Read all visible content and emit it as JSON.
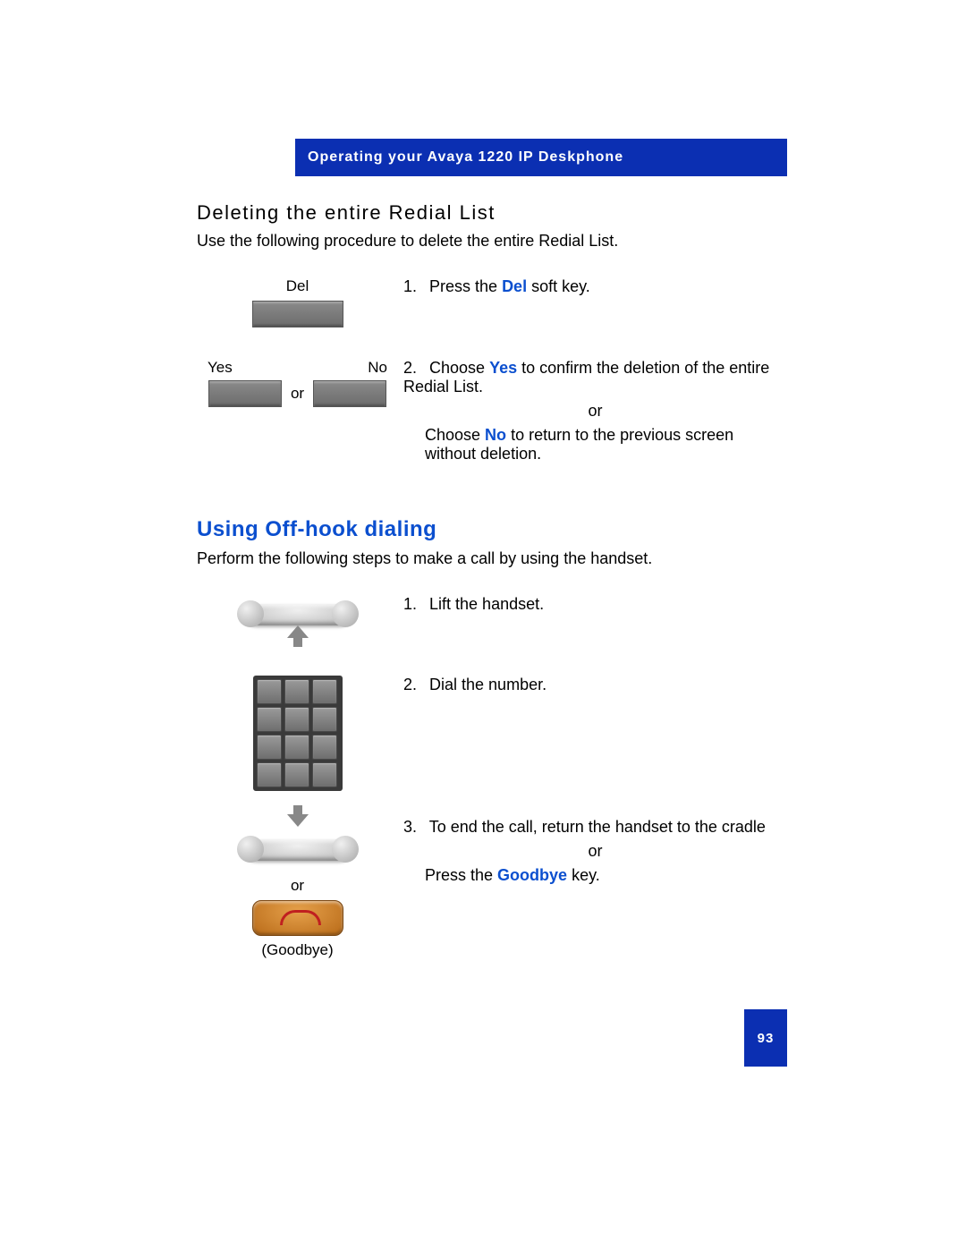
{
  "header": {
    "title": "Operating your Avaya 1220 IP Deskphone"
  },
  "common": {
    "or": "or"
  },
  "section1": {
    "heading": "Deleting the entire Redial List",
    "intro": "Use the following procedure to delete the entire Redial List.",
    "step1": {
      "keyLabel": "Del",
      "textPrefix": "Press the ",
      "highlight": "Del",
      "textSuffix": " soft key."
    },
    "step2": {
      "yesLabel": "Yes",
      "noLabel": "No",
      "line1Prefix": "Choose ",
      "yesHighlight": "Yes",
      "line1Suffix": " to confirm the deletion of the entire Redial List.",
      "line2Prefix": "Choose ",
      "noHighlight": "No",
      "line2Suffix": " to return to the previous screen without deletion."
    }
  },
  "section2": {
    "heading": "Using Off-hook dialing",
    "intro": "Perform the following steps to make a call by using the handset.",
    "step1": "Lift the handset.",
    "step2": "Dial the number.",
    "step3a": "To end the call, return the handset to the cradle",
    "step3bPrefix": "Press the ",
    "step3bHighlight": "Goodbye",
    "step3bSuffix": " key.",
    "goodbyeLabel": "(Goodbye)"
  },
  "page": {
    "number": "93"
  }
}
